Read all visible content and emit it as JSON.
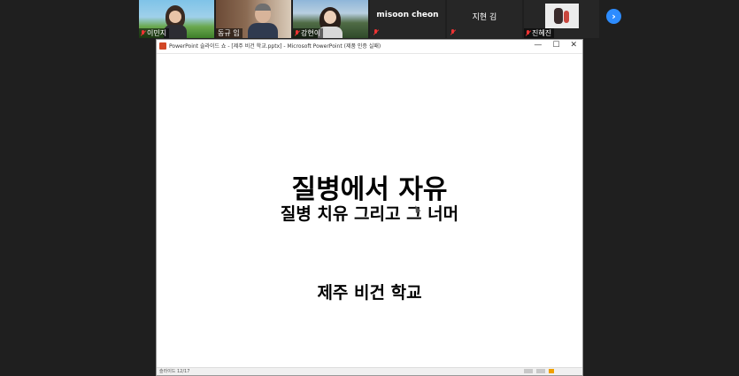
{
  "participants": [
    {
      "name": "이민지",
      "video": true
    },
    {
      "name": "동규 임",
      "video": true
    },
    {
      "name": "강현이",
      "video": true
    },
    {
      "name": "misoon cheon",
      "video": false
    },
    {
      "name": "지현 김",
      "video": false
    },
    {
      "name": "진혜진",
      "video": true
    }
  ],
  "window": {
    "title": "PowerPoint 슬라이드 쇼 - [제주 비건 학교.pptx] - Microsoft PowerPoint (제품 인증 실패)",
    "controls": {
      "minimize": "—",
      "maximize": "☐",
      "close": "✕"
    }
  },
  "slide": {
    "title": "질병에서 자유",
    "subtitle": "질병 치유 그리고 그 너머",
    "footer": "제주 비건 학교"
  },
  "statusbar": {
    "text": "슬라이드 12/17"
  },
  "icons": {
    "next": "chevron-right-icon",
    "mic": "mic-muted-icon"
  }
}
